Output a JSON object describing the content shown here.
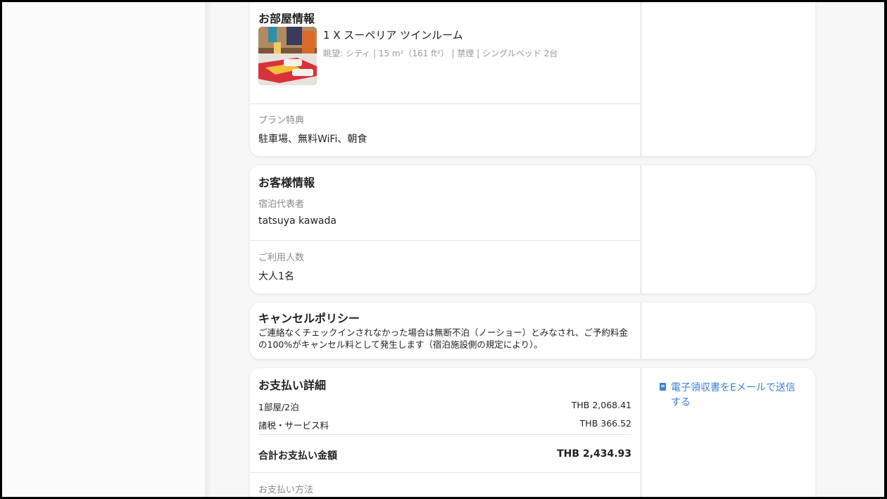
{
  "room": {
    "heading": "お部屋情報",
    "title": "1 X スーペリア ツインルーム",
    "meta": "眺望: シティ | 15 m²（161 ft²） | 禁煙 | シングルベッド 2台",
    "benefits_label": "プラン特典",
    "benefits_value": "駐車場、無料WiFi、朝食"
  },
  "guest": {
    "heading": "お客様情報",
    "lead_label": "宿泊代表者",
    "lead_value": "tatsuya kawada",
    "count_label": "ご利用人数",
    "count_value": "大人1名"
  },
  "cancel": {
    "heading": "キャンセルポリシー",
    "text": "ご連絡なくチェックインされなかった場合は無断不泊（ノーショー）とみなされ、ご予約料金の100%がキャンセル料として発生します（宿泊施設側の規定により）。"
  },
  "payment": {
    "heading": "お支払い詳細",
    "rows": [
      {
        "label": "1部屋/2泊",
        "amount": "THB 2,068.41"
      },
      {
        "label": "諸税・サービス料",
        "amount": "THB 366.52"
      }
    ],
    "total_label": "合計お支払い金額",
    "total_amount": "THB 2,434.93",
    "method_label": "お支払い方法",
    "receipt_link": "電子領収書をEメールで送信する",
    "link_color": "#3a7fd6"
  }
}
